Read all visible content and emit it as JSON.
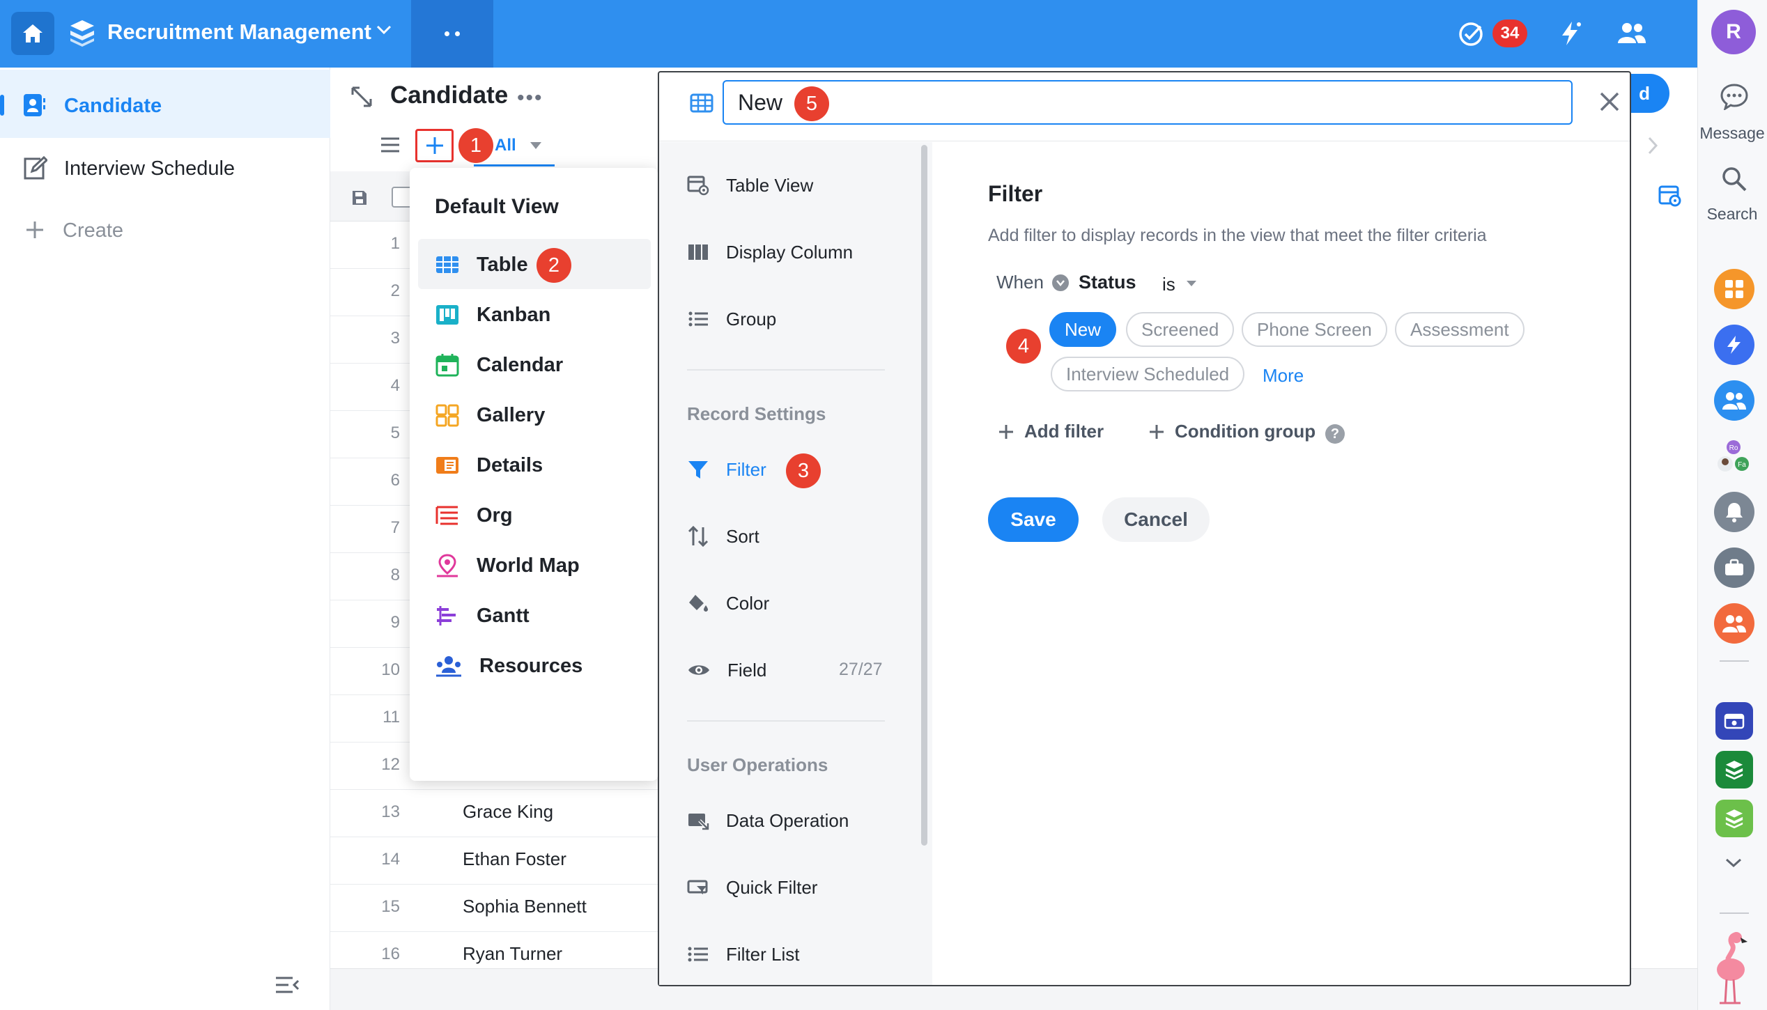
{
  "topbar": {
    "app_title": "Recruitment Management",
    "todo_count": "34"
  },
  "user": {
    "avatar_initial": "R"
  },
  "sidebar": {
    "items": [
      {
        "label": "Candidate",
        "icon": "contact-card-icon",
        "active": true
      },
      {
        "label": "Interview Schedule",
        "icon": "edit-icon"
      },
      {
        "label": "Create",
        "icon": "plus-icon"
      }
    ]
  },
  "main": {
    "title": "Candidate",
    "tab_all": "All",
    "button_partial": "d",
    "rows": [
      {
        "num": "1",
        "name": ""
      },
      {
        "num": "2",
        "name": ""
      },
      {
        "num": "3",
        "name": ""
      },
      {
        "num": "4",
        "name": ""
      },
      {
        "num": "5",
        "name": ""
      },
      {
        "num": "6",
        "name": ""
      },
      {
        "num": "7",
        "name": ""
      },
      {
        "num": "8",
        "name": ""
      },
      {
        "num": "9",
        "name": ""
      },
      {
        "num": "10",
        "name": ""
      },
      {
        "num": "11",
        "name": ""
      },
      {
        "num": "12",
        "name": ""
      },
      {
        "num": "13",
        "name": "Grace King"
      },
      {
        "num": "14",
        "name": "Ethan Foster"
      },
      {
        "num": "15",
        "name": "Sophia Bennett"
      },
      {
        "num": "16",
        "name": "Ryan Turner"
      }
    ]
  },
  "view_menu": {
    "title": "Default View",
    "items": [
      {
        "label": "Table",
        "icon": "table-icon",
        "color": "#2f8fef"
      },
      {
        "label": "Kanban",
        "icon": "kanban-icon",
        "color": "#1ab0c8"
      },
      {
        "label": "Calendar",
        "icon": "calendar-icon",
        "color": "#1fb35a"
      },
      {
        "label": "Gallery",
        "icon": "gallery-icon",
        "color": "#f4a623"
      },
      {
        "label": "Details",
        "icon": "details-icon",
        "color": "#f07d1a"
      },
      {
        "label": "Org",
        "icon": "org-icon",
        "color": "#e8322e"
      },
      {
        "label": "World Map",
        "icon": "map-pin-icon",
        "color": "#e0389b"
      },
      {
        "label": "Gantt",
        "icon": "gantt-icon",
        "color": "#8c3fd9"
      },
      {
        "label": "Resources",
        "icon": "resources-icon",
        "color": "#2a5fd6"
      }
    ]
  },
  "modal": {
    "view_name": "New",
    "nav": {
      "items_top": [
        {
          "label": "Table View",
          "icon": "table-view-icon"
        },
        {
          "label": "Display Column",
          "icon": "columns-icon"
        },
        {
          "label": "Group",
          "icon": "group-list-icon"
        }
      ],
      "record_section": "Record Settings",
      "items_record": [
        {
          "label": "Filter",
          "icon": "filter-icon",
          "active": true
        },
        {
          "label": "Sort",
          "icon": "sort-icon"
        },
        {
          "label": "Color",
          "icon": "paint-bucket-icon"
        },
        {
          "label": "Field",
          "icon": "eye-icon",
          "count": "27/27"
        }
      ],
      "user_section": "User Operations",
      "items_user": [
        {
          "label": "Data Operation",
          "icon": "data-operation-icon"
        },
        {
          "label": "Quick Filter",
          "icon": "quick-filter-icon"
        },
        {
          "label": "Filter List",
          "icon": "filter-list-icon"
        }
      ]
    },
    "filter": {
      "title": "Filter",
      "description": "Add filter to display records in the view that meet the filter criteria",
      "when": "When",
      "field": "Status",
      "operator": "is",
      "options": [
        "New",
        "Screened",
        "Phone Screen",
        "Assessment",
        "Interview Scheduled"
      ],
      "selected": "New",
      "more": "More",
      "add_filter": "Add filter",
      "condition_group": "Condition group",
      "save": "Save",
      "cancel": "Cancel"
    }
  },
  "rail": {
    "message": "Message",
    "search": "Search"
  },
  "steps": [
    "1",
    "2",
    "3",
    "4",
    "5"
  ],
  "colors": {
    "primary": "#1a84f3",
    "topbar": "#2f8fef",
    "marker": "#e8402f"
  }
}
